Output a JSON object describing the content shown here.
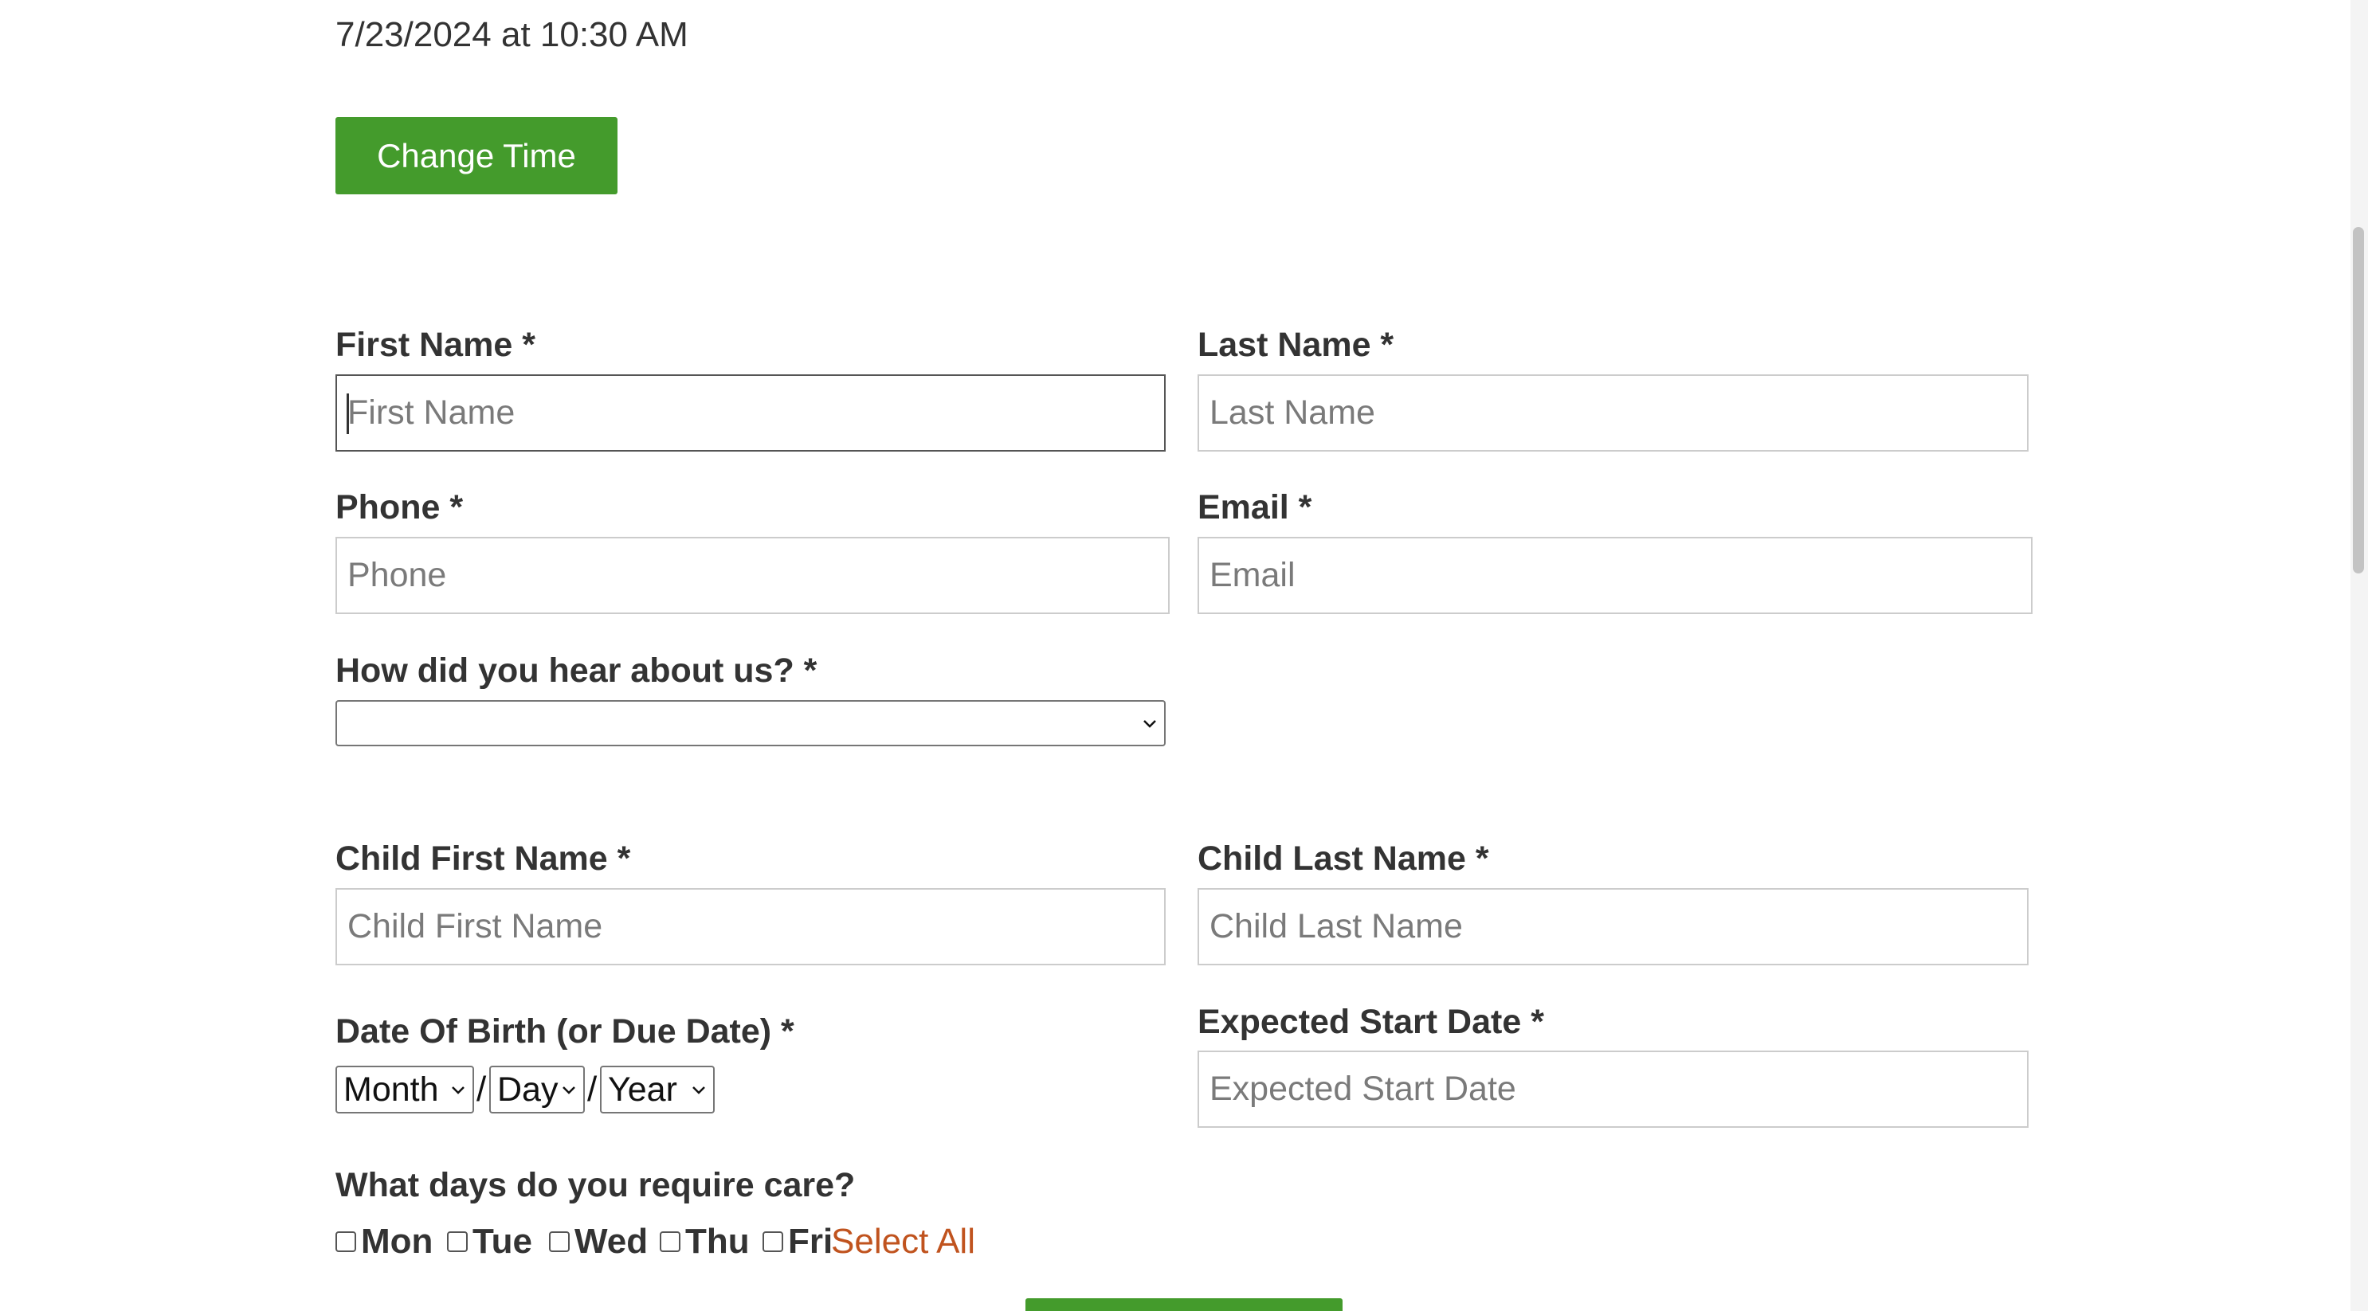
{
  "appointment": {
    "datetime_text": "7/23/2024 at 10:30 AM",
    "change_time_label": "Change Time"
  },
  "form": {
    "first_name": {
      "label": "First Name *",
      "placeholder": "First Name",
      "value": ""
    },
    "last_name": {
      "label": "Last Name *",
      "placeholder": "Last Name",
      "value": ""
    },
    "phone": {
      "label": "Phone *",
      "placeholder": "Phone",
      "value": ""
    },
    "email": {
      "label": "Email *",
      "placeholder": "Email",
      "value": ""
    },
    "hear_about": {
      "label": "How did you hear about us? *",
      "selected": ""
    },
    "child_first_name": {
      "label": "Child First Name *",
      "placeholder": "Child First Name",
      "value": ""
    },
    "child_last_name": {
      "label": "Child Last Name *",
      "placeholder": "Child Last Name",
      "value": ""
    },
    "dob": {
      "label": "Date Of Birth (or Due Date) *",
      "month": "Month",
      "day": "Day",
      "year": "Year",
      "separator": "/"
    },
    "expected_start": {
      "label": "Expected Start Date *",
      "placeholder": "Expected Start Date",
      "value": ""
    },
    "care_days": {
      "label": "What days do you require care?",
      "days": [
        {
          "label": "Mon",
          "checked": false
        },
        {
          "label": "Tue",
          "checked": false
        },
        {
          "label": "Wed",
          "checked": false
        },
        {
          "label": "Thu",
          "checked": false
        },
        {
          "label": "Fri",
          "checked": false
        }
      ],
      "select_all_label": "Select All"
    }
  },
  "colors": {
    "button_green": "#449b2c",
    "select_all_link": "#c0531e",
    "text": "#333333",
    "placeholder": "#7a7a7a"
  },
  "icons": {
    "dropdown": "chevron-down-icon"
  }
}
